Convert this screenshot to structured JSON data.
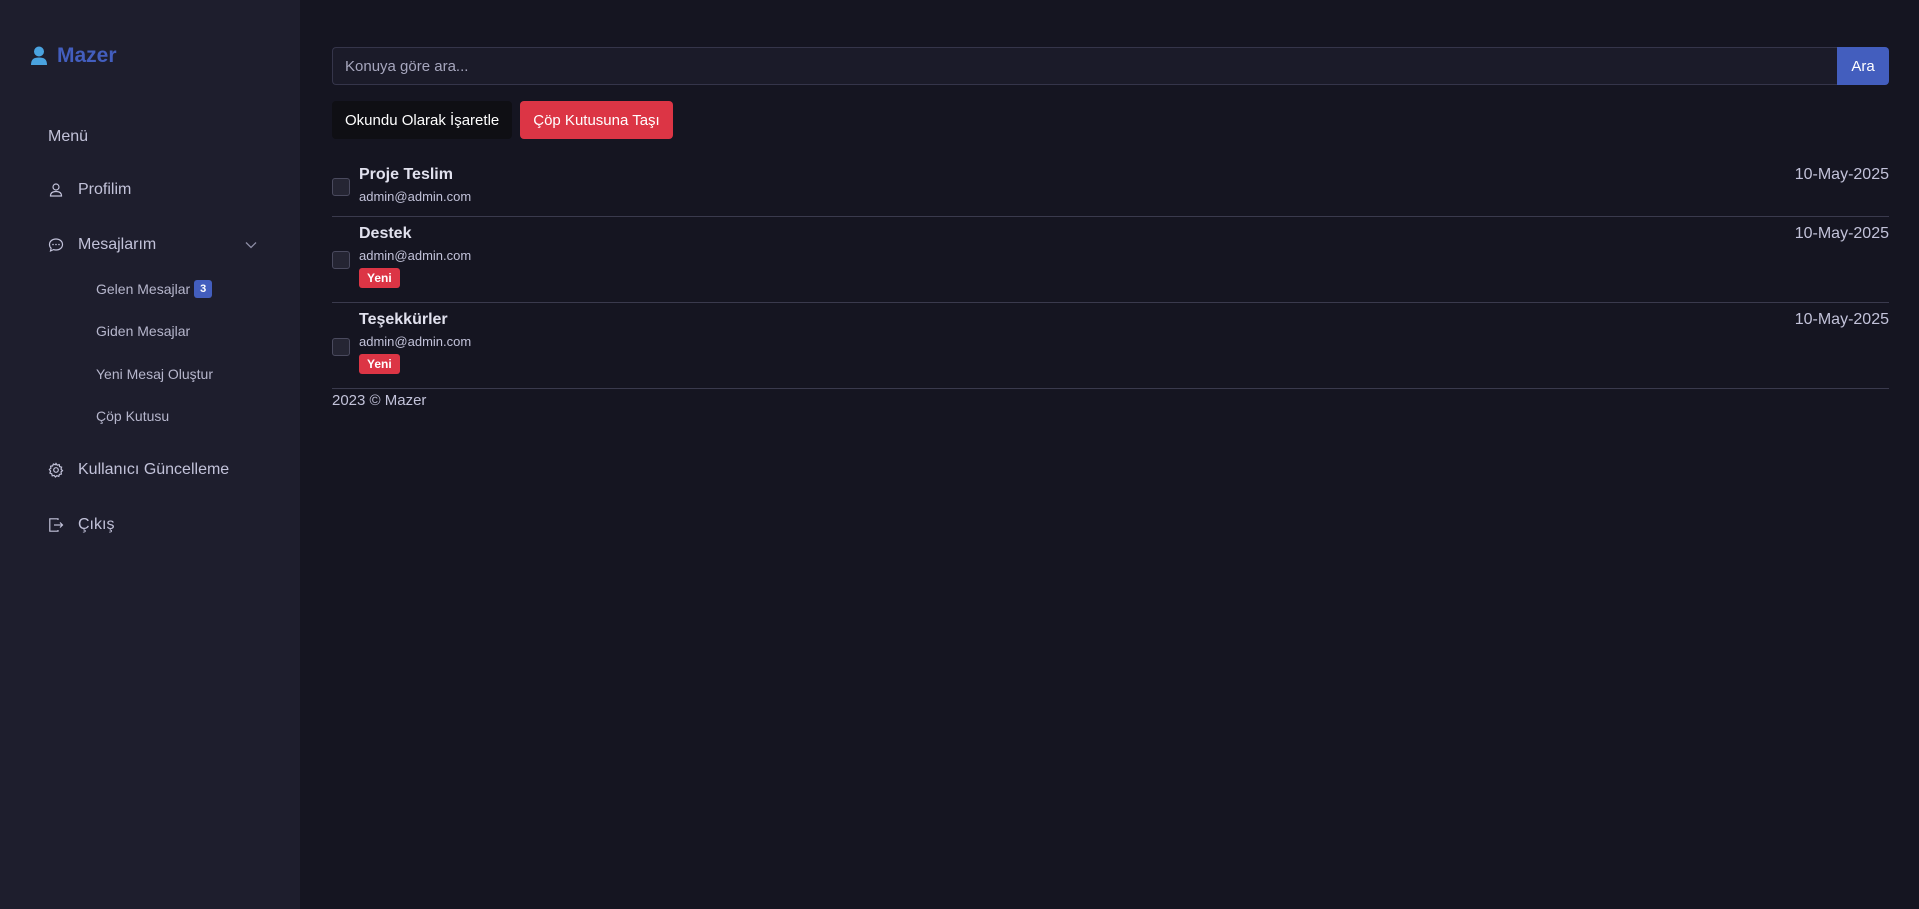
{
  "brand": {
    "name": "Mazer",
    "icon": "person-icon",
    "color": "#435ebe"
  },
  "sidebar": {
    "menu_title": "Menü",
    "items": [
      {
        "label": "Profilim",
        "icon": "person-icon"
      },
      {
        "label": "Mesajlarım",
        "icon": "chat-icon",
        "sub_items": [
          {
            "label": "Gelen Mesajlar",
            "badge": "3"
          },
          {
            "label": "Giden Mesajlar"
          },
          {
            "label": "Yeni Mesaj Oluştur"
          },
          {
            "label": "Çöp Kutusu"
          }
        ]
      },
      {
        "label": "Kullanıcı Güncelleme",
        "icon": "gear-icon"
      },
      {
        "label": "Çıkış",
        "icon": "logout-icon"
      }
    ]
  },
  "search": {
    "placeholder": "Konuya göre ara...",
    "value": "",
    "button": "Ara"
  },
  "actions": {
    "mark_read": "Okundu Olarak İşaretle",
    "move_trash": "Çöp Kutusuna Taşı"
  },
  "messages": [
    {
      "subject": "Proje Teslim",
      "sender": "admin@admin.com",
      "date": "10-May-2025",
      "badge": ""
    },
    {
      "subject": "Destek",
      "sender": "admin@admin.com",
      "date": "10-May-2025",
      "badge": "Yeni"
    },
    {
      "subject": "Teşekkürler",
      "sender": "admin@admin.com",
      "date": "10-May-2025",
      "badge": "Yeni"
    }
  ],
  "footer": {
    "text": "2023 © Mazer"
  },
  "colors": {
    "primary": "#435ebe",
    "danger": "#dc3545",
    "sidebar_bg": "#1e1e2d",
    "page_bg": "#151521"
  }
}
